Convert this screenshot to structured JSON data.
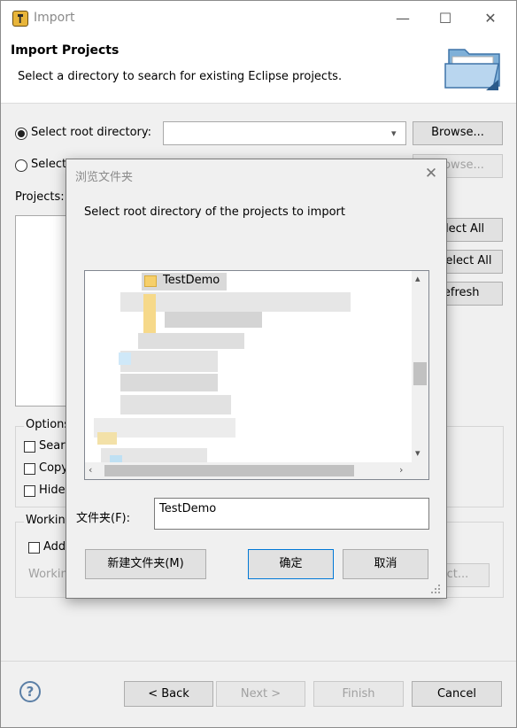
{
  "window": {
    "title": "Import",
    "controls": {
      "minimize": "—",
      "maximize": "☐",
      "close": "✕"
    }
  },
  "header": {
    "title": "Import Projects",
    "description": "Select a directory to search for existing Eclipse projects."
  },
  "source": {
    "root_directory_label": "Select root directory:",
    "root_directory_value": "",
    "archive_label": "Select",
    "browse_label": "Browse...",
    "browse2_label": "Browse..."
  },
  "projects": {
    "label": "Projects:",
    "select_all_label": "Select All",
    "deselect_all_label": "Deselect All",
    "refresh_label": "Refresh"
  },
  "options": {
    "label": "Options",
    "items": [
      {
        "label": "Search",
        "checked": false
      },
      {
        "label": "Copy",
        "checked": false
      },
      {
        "label": "Hide",
        "checked": false
      }
    ]
  },
  "working_sets": {
    "label": "Working",
    "add_label": "Add",
    "working_label": "Working",
    "select_label": "Select..."
  },
  "footer": {
    "help_icon": "?",
    "back_label": "< Back",
    "next_label": "Next >",
    "finish_label": "Finish",
    "cancel_label": "Cancel"
  },
  "dialog": {
    "title": "浏览文件夹",
    "description": "Select root directory of the projects to import",
    "tree": {
      "selected_item": "TestDemo"
    },
    "folder_label": "文件夹(F):",
    "folder_value": "TestDemo",
    "new_folder_label": "新建文件夹(M)",
    "ok_label": "确定",
    "cancel_label": "取消"
  },
  "colors": {
    "accent_blue": "#0078d7",
    "dialog_bg": "#f0f0f0",
    "folder_yellow": "#f6cf6a"
  }
}
